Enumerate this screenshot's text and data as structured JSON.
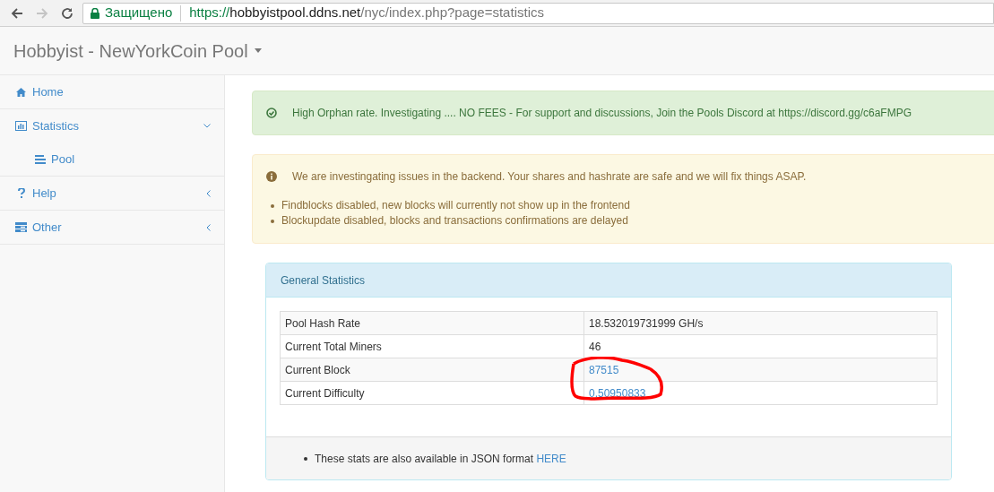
{
  "browser": {
    "security_label": "Защищено",
    "url": {
      "scheme": "https://",
      "host": "hobbyistpool.ddns.net",
      "path": "/nyc/index.php?page=statistics"
    }
  },
  "navbar": {
    "brand": "Hobbyist - NewYorkCoin Pool"
  },
  "sidebar": {
    "items": [
      {
        "label": "Home"
      },
      {
        "label": "Statistics",
        "expanded": true,
        "children": [
          {
            "label": "Pool"
          }
        ]
      },
      {
        "label": "Help",
        "expanded": false
      },
      {
        "label": "Other",
        "expanded": false
      }
    ]
  },
  "alerts": [
    {
      "kind": "success",
      "message": "High Orphan rate. Investigating .... NO FEES - For support and discussions, Join the Pools Discord at https://discord.gg/c6aFMPG"
    },
    {
      "kind": "warning",
      "message": "We are investingating issues in the backend. Your shares and hashrate are safe and we will fix things ASAP.",
      "bullets": [
        "Findblocks disabled, new blocks will currently not show up in the frontend",
        "Blockupdate disabled, blocks and transactions confirmations are delayed"
      ]
    }
  ],
  "panel": {
    "title": "General Statistics",
    "rows": [
      {
        "label": "Pool Hash Rate",
        "value": "18.532019731999 GH/s",
        "link": false
      },
      {
        "label": "Current Total Miners",
        "value": "46",
        "link": false
      },
      {
        "label": "Current Block",
        "value": "87515",
        "link": true
      },
      {
        "label": "Current Difficulty",
        "value": "0.50950833",
        "link": true
      }
    ],
    "footer_text": "These stats are also available in JSON format",
    "footer_link": "HERE"
  }
}
